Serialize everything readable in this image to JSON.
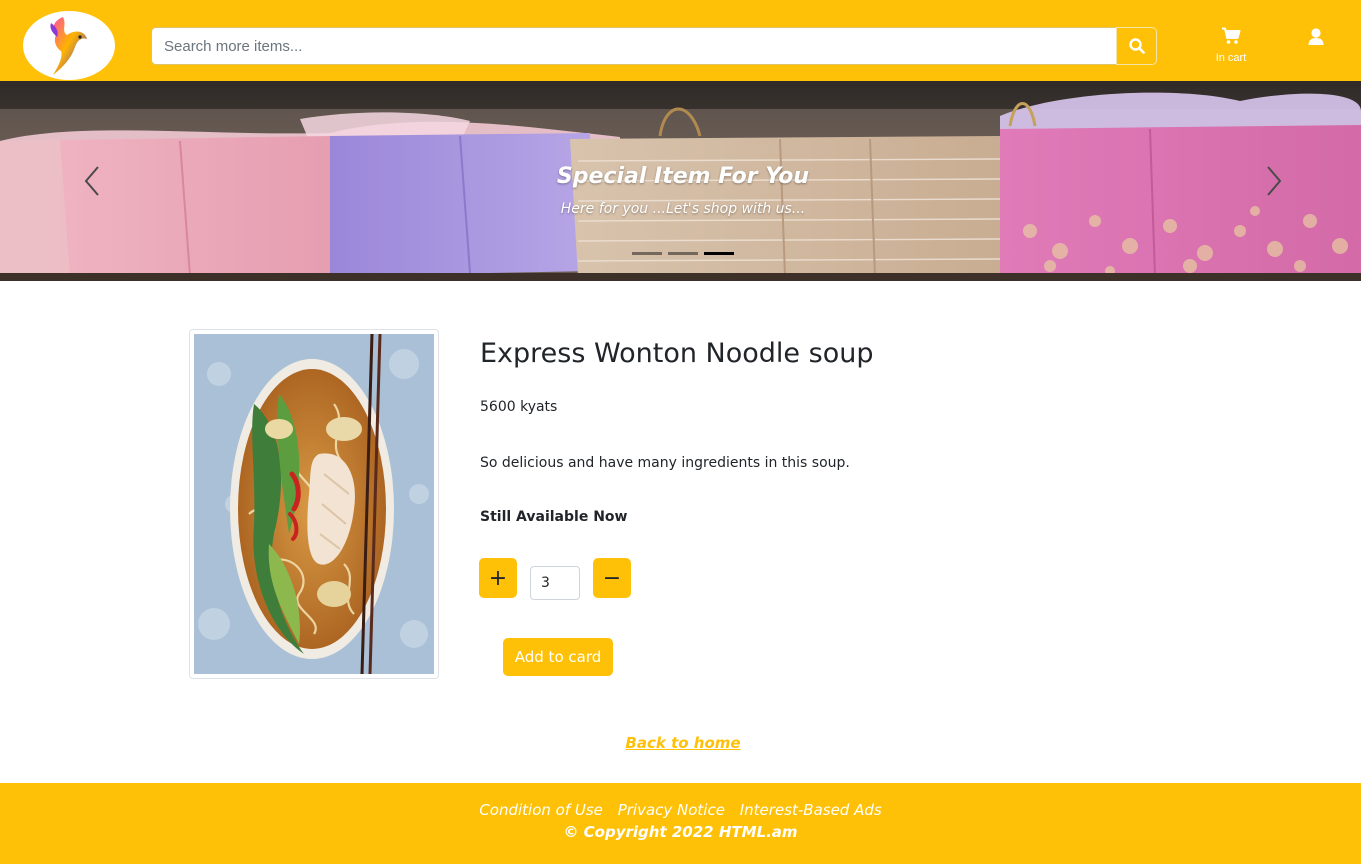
{
  "header": {
    "search_placeholder": "Search more items...",
    "cart_label": "In cart"
  },
  "carousel": {
    "title": "Special Item For You",
    "subtitle": "Here for you ...Let's shop with us...",
    "indicator_count": 3,
    "active_indicator": 3
  },
  "product": {
    "title": "Express Wonton Noodle soup",
    "price": "5600 kyats",
    "description": "So delicious and have many ingredients in this soup.",
    "availability": "Still Available Now",
    "quantity": "3",
    "plus_label": "+",
    "minus_label": "−",
    "add_button_label": "Add to card"
  },
  "back_link": "Back to home",
  "footer": {
    "links": [
      "Condition of Use",
      "Privacy Notice",
      "Interest-Based Ads"
    ],
    "copyright": "© Copyright 2022 HTML.am"
  },
  "colors": {
    "accent": "#ffc107",
    "text": "#212529"
  }
}
